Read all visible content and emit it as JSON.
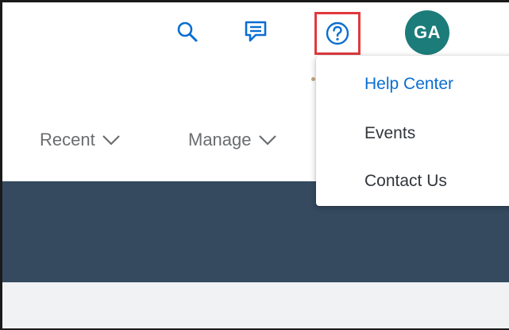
{
  "shell": {
    "avatar_initials": "GA",
    "icons": [
      "search-icon",
      "feedback-icon",
      "help-icon"
    ]
  },
  "nav": [
    {
      "label": "Recent"
    },
    {
      "label": "Manage"
    }
  ],
  "help_menu": {
    "items": [
      {
        "label": "Help Center",
        "active": true
      },
      {
        "label": "Events"
      },
      {
        "label": "Contact Us"
      }
    ]
  },
  "colors": {
    "accent": "#0a6ed1",
    "avatar_bg": "#1b7c7a",
    "highlight_border": "#e0393e",
    "header_band": "#354a5f",
    "page_bg": "#f1f2f4",
    "nav_text": "#6a6d70"
  }
}
